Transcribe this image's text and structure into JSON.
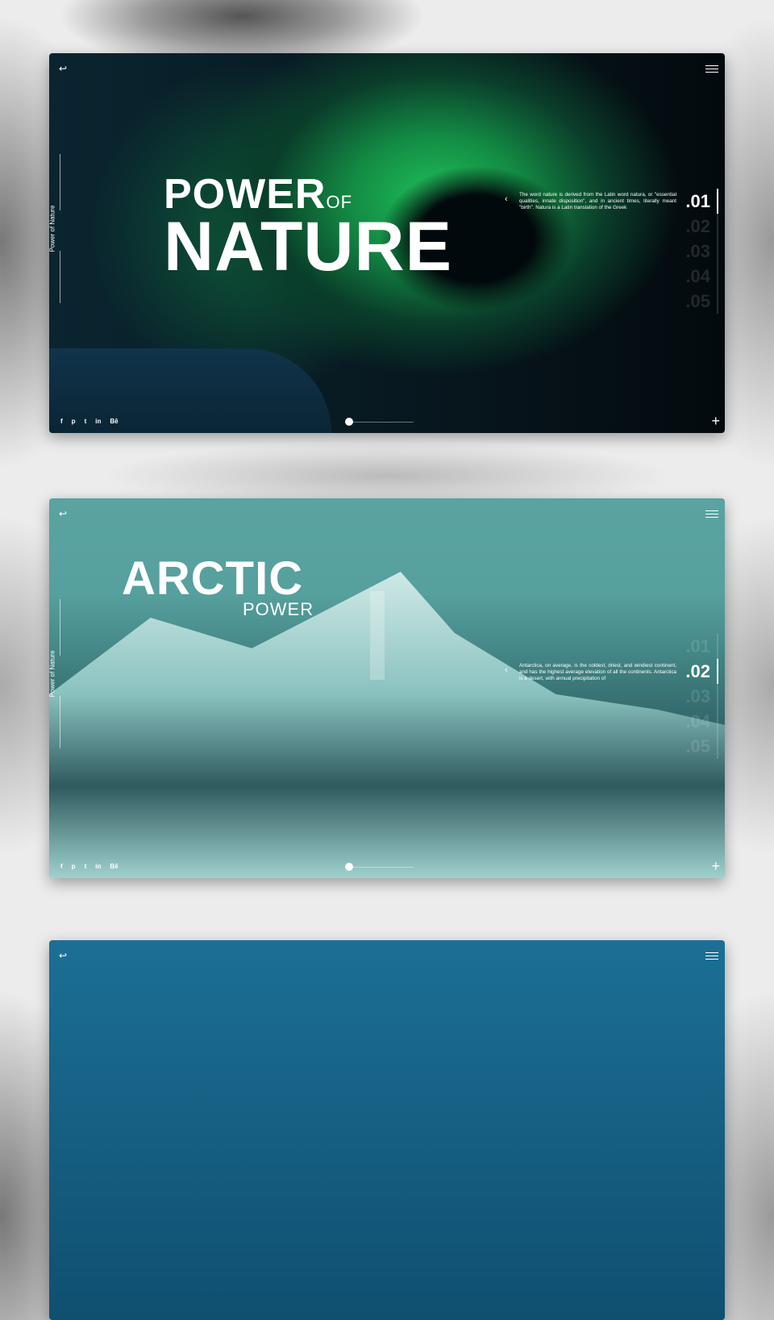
{
  "slides": [
    {
      "title_main": "POWER",
      "title_small": "OF",
      "title_big": "NATURE",
      "side_label": "Power of Nature",
      "description": "The word nature is derived from the Latin word natura, or \"essential qualities, innate disposition\", and in ancient times, literally meant \"birth\". Natura is a Latin translation of the Greek",
      "numbers": [
        ".01",
        ".02",
        ".03",
        ".04",
        ".05"
      ],
      "active": 0
    },
    {
      "title_main": "ARCTIC",
      "title_sub": "POWER",
      "side_label": "Power of Nature",
      "description": "Antarctica, on average, is the coldest, driest, and windiest continent, and has the highest average elevation of all the continents. Antarctica is a desert, with annual precipitation of",
      "numbers": [
        ".01",
        ".02",
        ".03",
        ".04",
        ".05"
      ],
      "active": 1
    }
  ],
  "social": [
    "f",
    "p",
    "t",
    "in",
    "Bē"
  ],
  "icons": {
    "back": "↩",
    "prev": "‹",
    "plus": "+"
  }
}
